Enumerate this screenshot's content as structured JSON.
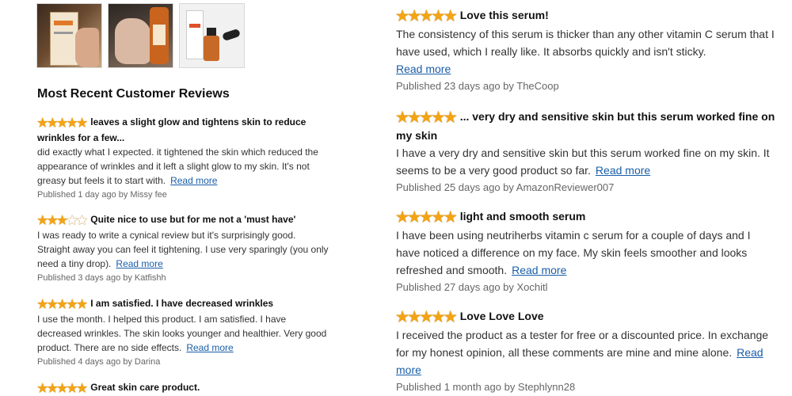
{
  "thumbnails": [
    {
      "icon": "product-box-photo"
    },
    {
      "icon": "serum-on-palm-photo"
    },
    {
      "icon": "bottle-and-dropper-photo"
    }
  ],
  "section_heading": "Most Recent Customer Reviews",
  "read_more_label": "Read more",
  "star_color": "#f3a313",
  "left_reviews": [
    {
      "stars": 5,
      "title": "leaves a slight glow and tightens skin to reduce wrinkles for a few...",
      "body": "did exactly what I expected. it tightened the skin which reduced the appearance of wrinkles and it left a slight glow to my skin. It's not greasy but feels it to start with.",
      "meta": "Published 1 day ago by Missy fee"
    },
    {
      "stars": 3,
      "title": "Quite nice to use but for me not a 'must have'",
      "body": "I was ready to write a cynical review but it's surprisingly good. Straight away you can feel it tightening. I use very sparingly (you only need a tiny drop).",
      "meta": "Published 3 days ago by Katfishh"
    },
    {
      "stars": 5,
      "title": "I am satisfied. I have decreased wrinkles",
      "body": "I use the month. I helped this product. I am satisfied. I have decreased wrinkles. The skin looks younger and healthier. Very good product. There are no side effects.",
      "meta": "Published 4 days ago by Darina"
    },
    {
      "stars": 5,
      "title": "Great skin care product.",
      "body": "",
      "meta": ""
    }
  ],
  "right_reviews": [
    {
      "stars": 5,
      "title": "Love this serum!",
      "body": "The consistency of this serum is thicker than any other vitamin C serum that I have used, which I really like. It absorbs quickly and isn't sticky.",
      "meta": "Published 23 days ago by TheCoop"
    },
    {
      "stars": 5,
      "title": "... very dry and sensitive skin but this serum worked fine on my skin",
      "body": "I have a very dry and sensitive skin but this serum worked fine on my skin. It seems to be a very good product so far.",
      "meta": "Published 25 days ago by AmazonReviewer007"
    },
    {
      "stars": 5,
      "title": "light and smooth serum",
      "body": "I have been using neutriherbs vitamin c serum for a couple of days and I have noticed a difference on my face. My skin feels smoother and looks refreshed and smooth.",
      "meta": "Published 27 days ago by Xochitl"
    },
    {
      "stars": 5,
      "title": "Love Love Love",
      "body": "I received the product as a tester for free or a discounted price. In exchange for my honest opinion, all these comments are mine and mine alone.",
      "meta": "Published 1 month ago by Stephlynn28"
    }
  ]
}
